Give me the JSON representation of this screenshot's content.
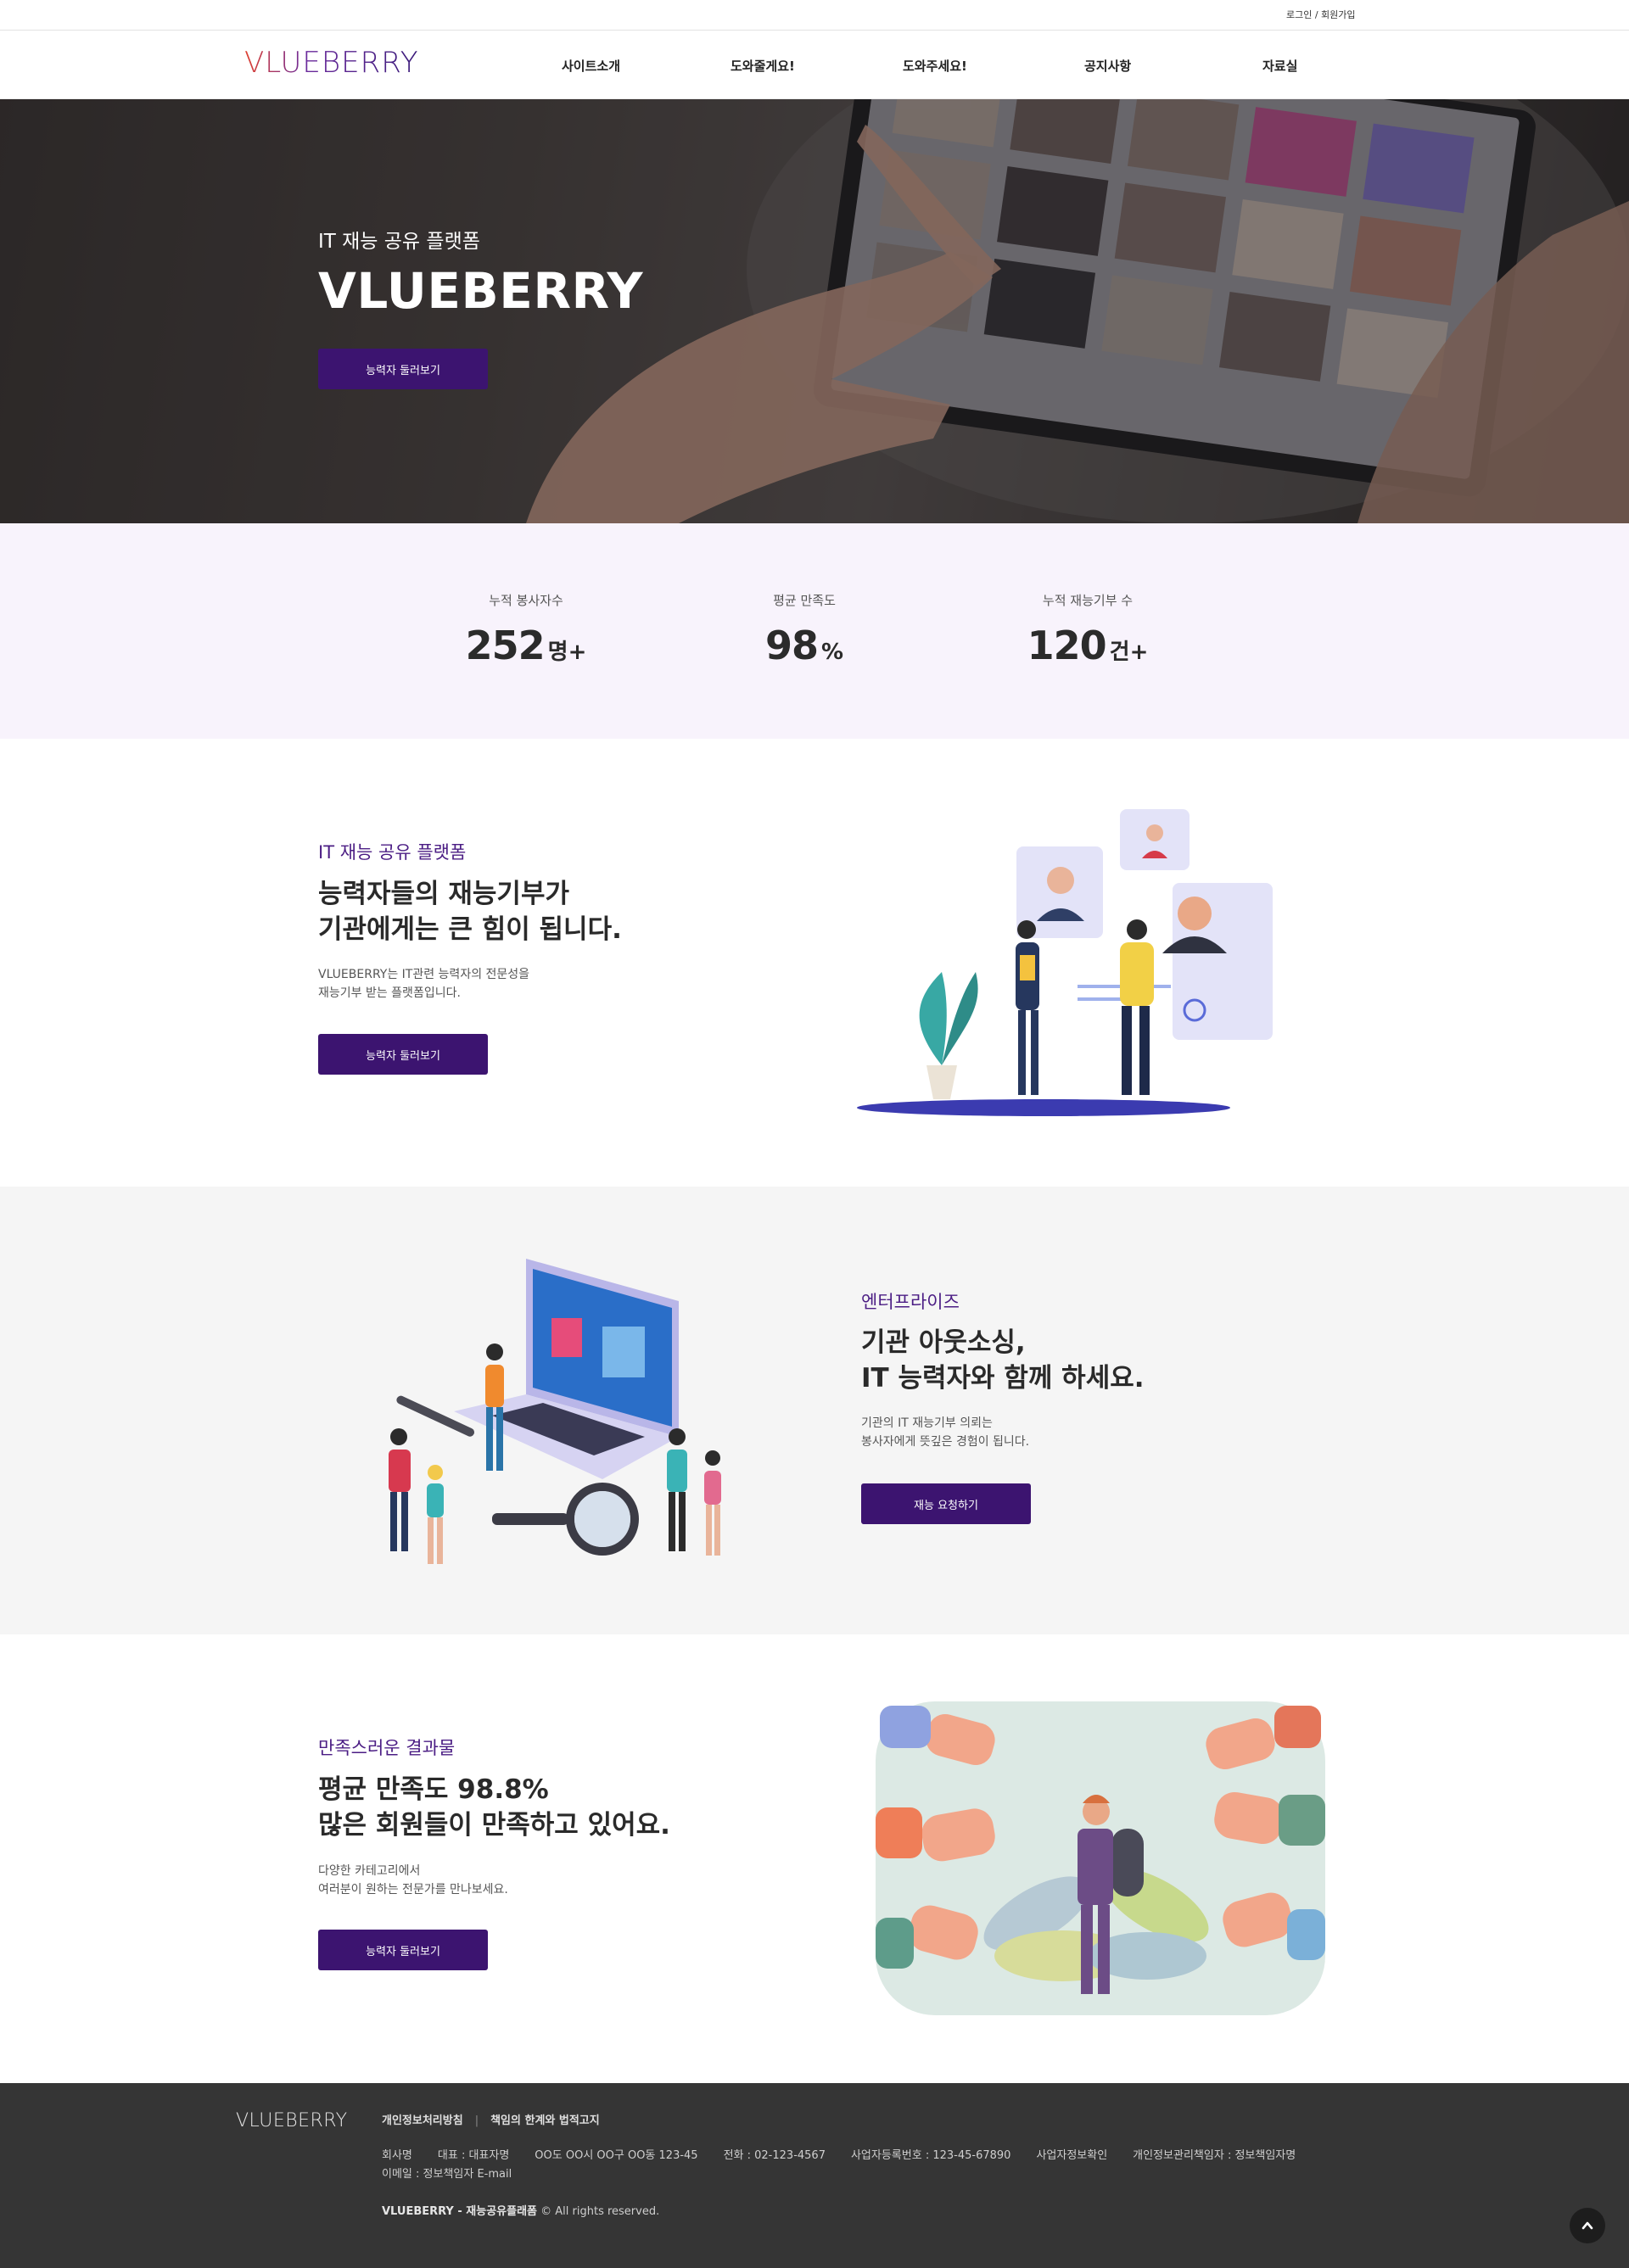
{
  "topbar": {
    "login_label": "로그인 / 회원가입"
  },
  "header": {
    "logo_text": "VLUEBERRY",
    "nav": [
      "사이트소개",
      "도와줄게요!",
      "도와주세요!",
      "공지사항",
      "자료실"
    ]
  },
  "hero": {
    "subtitle": "IT 재능 공유 플랫폼",
    "title": "VLUEBERRY",
    "button_label": "능력자 둘러보기"
  },
  "stats": [
    {
      "label": "누적 봉사자수",
      "value": "252",
      "unit": "명+"
    },
    {
      "label": "평균 만족도",
      "value": "98",
      "unit": "%"
    },
    {
      "label": "누적 재능기부 수",
      "value": "120",
      "unit": "건+"
    }
  ],
  "section1": {
    "eyebrow": "IT 재능 공유 플랫폼",
    "heading_line1": "능력자들의 재능기부가",
    "heading_line2": "기관에게는 큰 힘이 됩니다.",
    "desc_line1": "VLUEBERRY는 IT관련 능력자의 전문성을",
    "desc_line2": "재능기부 받는 플랫폼입니다.",
    "button_label": "능력자 둘러보기"
  },
  "section2": {
    "eyebrow": "엔터프라이즈",
    "heading_line1": "기관 아웃소싱,",
    "heading_line2": "IT 능력자와 함께 하세요.",
    "desc_line1": "기관의 IT 재능기부 의뢰는",
    "desc_line2": "봉사자에게 뜻깊은 경험이 됩니다.",
    "button_label": "재능 요청하기"
  },
  "section3": {
    "eyebrow": "만족스러운 결과물",
    "heading_line1": "평균 만족도 98.8%",
    "heading_line2": "많은 회원들이 만족하고 있어요.",
    "desc_line1": "다양한 카테고리에서",
    "desc_line2": "여러분이 원하는 전문가를 만나보세요.",
    "button_label": "능력자 둘러보기"
  },
  "footer": {
    "logo_text": "VLUEBERRY",
    "link_privacy": "개인정보처리방침",
    "link_legal": "책임의 한계와 법적고지",
    "company": "회사명",
    "ceo": "대표 : 대표자명",
    "address": "OO도 OO시 OO구 OO동 123-45",
    "phone": "전화 : 02-123-4567",
    "biz_no": "사업자등록번호 : 123-45-67890",
    "biz_check": "사업자정보확인",
    "privacy_officer": "개인정보관리책임자 : 정보책임자명",
    "email": "이메일 : 정보책임자 E-mail",
    "copyright_brand": "VLUEBERRY - 재능공유플래폼",
    "copyright_rest": "© All rights reserved."
  },
  "colors": {
    "accent": "#3c1470",
    "eyebrow": "#4b1d84",
    "stats_bg": "#f8f3fc",
    "alt_bg": "#f5f5f5",
    "footer_bg": "#353535"
  },
  "icons": {
    "scroll_top": "chevron-up-icon"
  }
}
